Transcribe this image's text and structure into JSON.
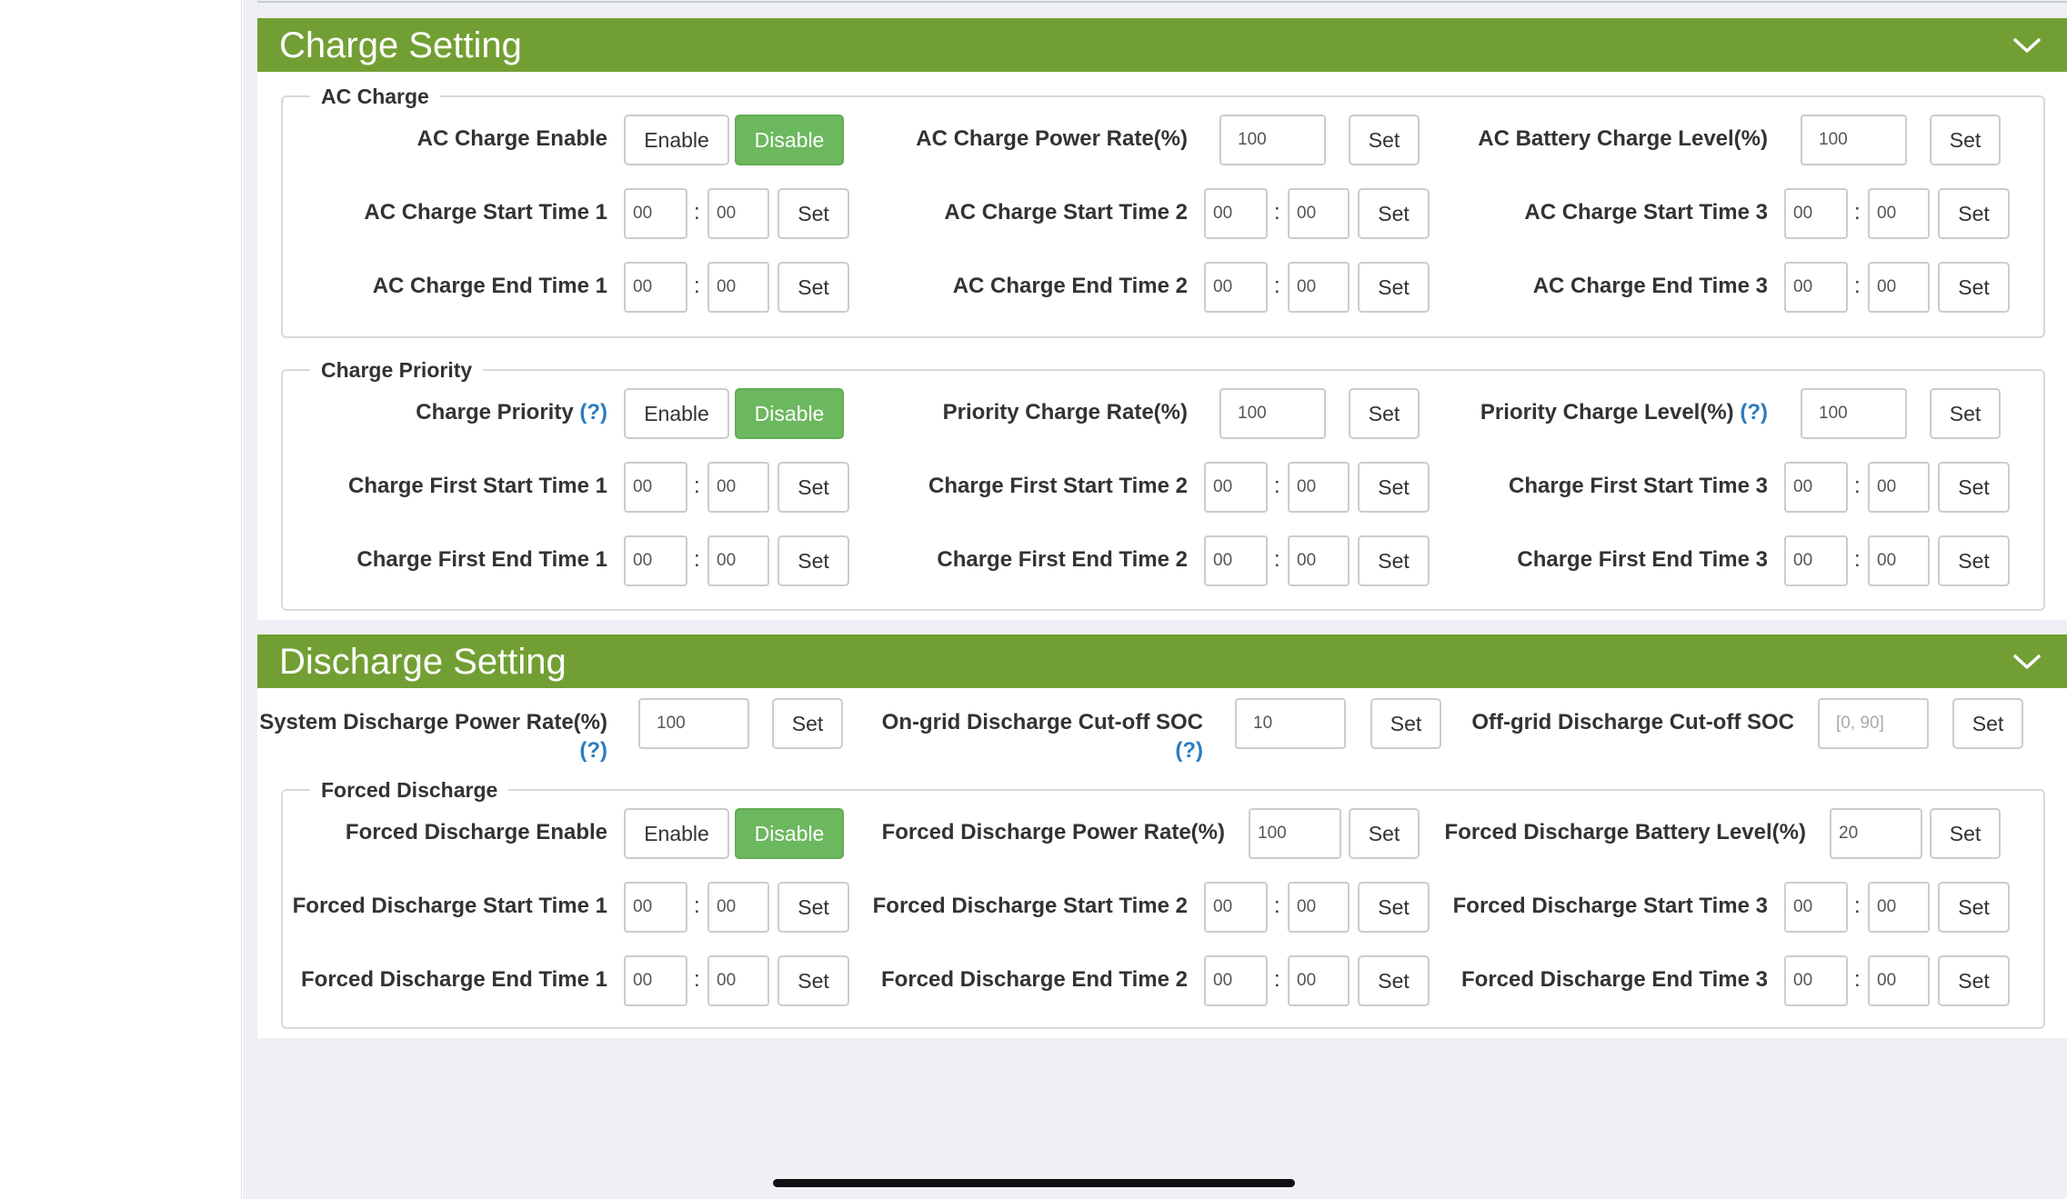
{
  "colors": {
    "header_green": "#729f33",
    "active_green": "#6cb85e",
    "help_blue": "#2b7bbf"
  },
  "common": {
    "enable": "Enable",
    "disable": "Disable",
    "set": "Set",
    "colon": ":",
    "help": "(?)"
  },
  "charge": {
    "title": "Charge Setting",
    "ac": {
      "legend": "AC Charge",
      "enable_label": "AC Charge Enable",
      "power_rate_label": "AC Charge Power Rate(%)",
      "power_rate_value": "100",
      "battery_level_label": "AC Battery Charge Level(%)",
      "battery_level_value": "100",
      "start1_label": "AC Charge Start Time 1",
      "start2_label": "AC Charge Start Time 2",
      "start3_label": "AC Charge Start Time 3",
      "end1_label": "AC Charge End Time 1",
      "end2_label": "AC Charge End Time 2",
      "end3_label": "AC Charge End Time 3",
      "time_value": "00"
    },
    "priority": {
      "legend": "Charge Priority",
      "priority_label": "Charge Priority",
      "rate_label": "Priority Charge Rate(%)",
      "rate_value": "100",
      "level_label": "Priority Charge Level(%)",
      "level_value": "100",
      "start1_label": "Charge First Start Time 1",
      "start2_label": "Charge First Start Time 2",
      "start3_label": "Charge First Start Time 3",
      "end1_label": "Charge First End Time 1",
      "end2_label": "Charge First End Time 2",
      "end3_label": "Charge First End Time 3",
      "time_value": "00"
    }
  },
  "discharge": {
    "title": "Discharge Setting",
    "sys_rate_label": "System Discharge Power Rate(%)",
    "sys_rate_value": "100",
    "ongrid_label": "On-grid Discharge Cut-off SOC",
    "ongrid_value": "10",
    "offgrid_label": "Off-grid Discharge Cut-off SOC",
    "offgrid_placeholder": "[0, 90]",
    "forced": {
      "legend": "Forced Discharge",
      "enable_label": "Forced Discharge Enable",
      "rate_label": "Forced Discharge Power Rate(%)",
      "rate_value": "100",
      "level_label": "Forced Discharge Battery Level(%)",
      "level_value": "20",
      "start1_label": "Forced Discharge Start Time 1",
      "start2_label": "Forced Discharge Start Time 2",
      "start3_label": "Forced Discharge Start Time 3",
      "end1_label": "Forced Discharge End Time 1",
      "end2_label": "Forced Discharge End Time 2",
      "end3_label": "Forced Discharge End Time 3",
      "time_value": "00"
    }
  }
}
